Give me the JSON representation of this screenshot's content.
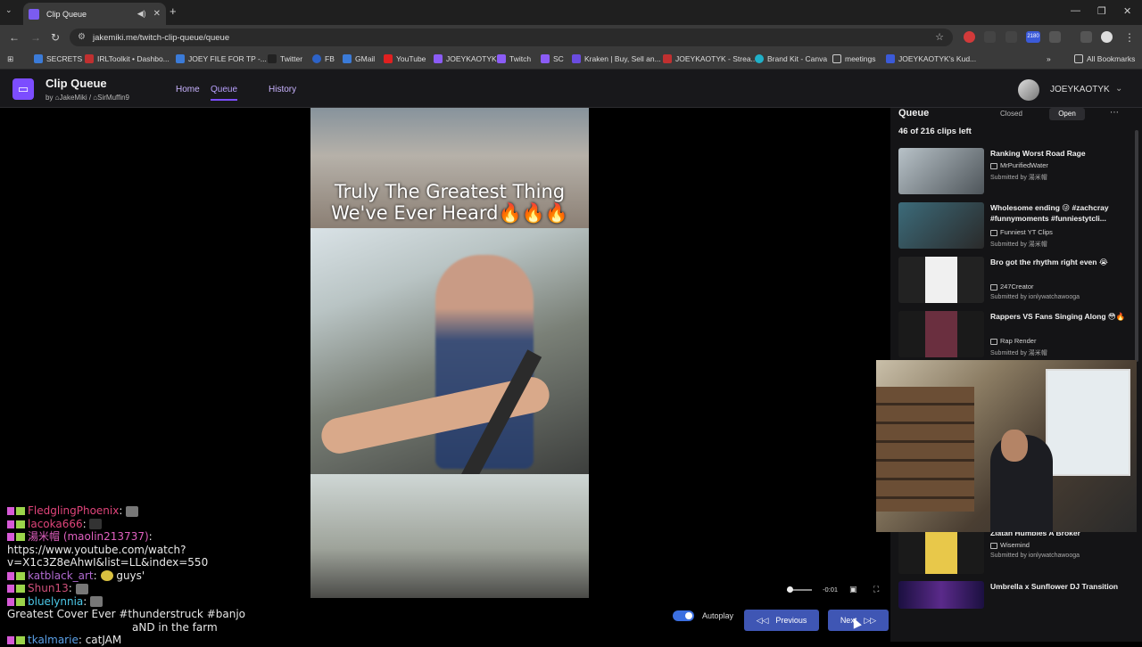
{
  "browser": {
    "tab_title": "Clip Queue",
    "url": "jakemiki.me/twitch-clip-queue/queue",
    "profile_badge": "2180",
    "bookmarks": [
      "SECRETS",
      "IRLToolkit • Dashbo...",
      "JOEY FILE FOR TP -...",
      "Twitter",
      "FB",
      "GMail",
      "YouTube",
      "JOEYKAOTYK",
      "Twitch",
      "SC",
      "Kraken | Buy, Sell an...",
      "JOEYKAOTYK - Strea...",
      "Brand Kit - Canva",
      "meetings",
      "JOEYKAOTYK's Kud..."
    ],
    "all_bookmarks": "All Bookmarks"
  },
  "app": {
    "title": "Clip Queue",
    "by_prefix": "by",
    "author1": "JakeMiki",
    "author2": "SirMuffin9",
    "nav": [
      "Home",
      "Queue",
      "History"
    ],
    "username": "JOEYKAOTYK"
  },
  "player": {
    "caption_line1": "Truly The Greatest Thing",
    "caption_line2": "We've Ever Heard🔥🔥🔥",
    "time_left": "-0:01",
    "volume_fraction": 0.1,
    "autoplay_label": "Autoplay",
    "autoplay_on": true,
    "previous_label": "Previous",
    "next_label": "Next"
  },
  "queue": {
    "title": "Queue",
    "closed_label": "Closed",
    "open_label": "Open",
    "count_text": "46 of 216 clips left",
    "items": [
      {
        "title": "Ranking Worst Road Rage",
        "channel": "MrPurifiedWater",
        "submitted": "Submitted by 湯米帽"
      },
      {
        "title": "Wholesome ending 😜 #zachcray #funnymoments #funniestytcli...",
        "channel": "Funniest YT Clips",
        "submitted": "Submitted by 湯米帽"
      },
      {
        "title": "Bro got the rhythm right even 😭",
        "channel": "247Creator",
        "submitted": "Submitted by ionlywatchawooga"
      },
      {
        "title": "Rappers VS Fans Singing Along 😳🔥",
        "channel": "Rap Render",
        "submitted": "Submitted by 湯米帽"
      },
      {
        "title": "Zlatan Humbles A Broker",
        "channel": "Wisemind",
        "submitted": "Submitted by ionlywatchawooga"
      },
      {
        "title": "Umbrella x Sunflower DJ Transition",
        "channel": "",
        "submitted": ""
      }
    ]
  },
  "chat": [
    {
      "user": "FledglingPhoenix",
      "color": "#e0447a",
      "msg": ""
    },
    {
      "user": "lacoka666",
      "color": "#e0447a",
      "msg": ""
    },
    {
      "user": "湯米帽 (maolin213737)",
      "color": "#e060c0",
      "msg": ""
    },
    {
      "user": "",
      "color": "#ffffff",
      "msg": "https://www.youtube.com/watch?"
    },
    {
      "user": "",
      "color": "#ffffff",
      "msg": "v=X1c3Z8eAhwI&list=LL&index=550"
    },
    {
      "user": "katblack_art",
      "color": "#b06ad0",
      "msg": "guys'"
    },
    {
      "user": "Shun13",
      "color": "#d0507a",
      "msg": ""
    },
    {
      "user": "bluelynnia",
      "color": "#4cc8e8",
      "msg": ""
    },
    {
      "user": "",
      "color": "#ffffff",
      "msg": "Greatest Cover Ever #thunderstruck #banjo"
    },
    {
      "user": "",
      "color": "#ffffff",
      "msg": "aND in the farm"
    },
    {
      "user": "tkalmarie",
      "color": "#5aa0e8",
      "msg": "catJAM"
    }
  ]
}
